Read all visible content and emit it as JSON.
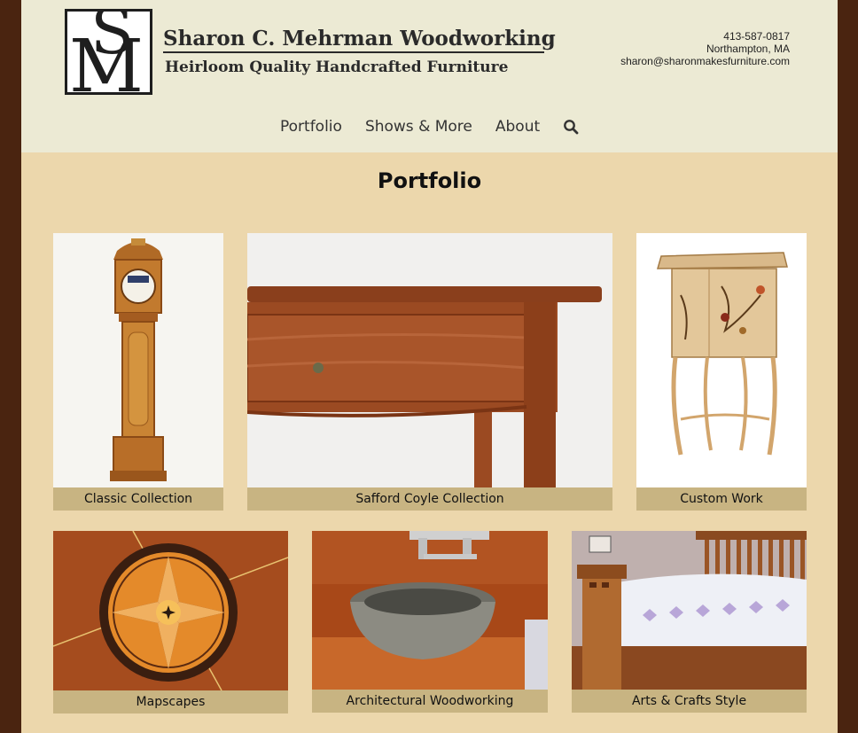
{
  "brand": {
    "logo_letters": "SM",
    "name": "Sharon C. Mehrman Woodworking",
    "tagline": "Heirloom Quality Handcrafted Furniture"
  },
  "contact": {
    "phone": "413-587-0817",
    "location": "Northampton, MA",
    "email": "sharon@sharonmakesfurniture.com"
  },
  "nav": {
    "items": [
      {
        "label": "Portfolio"
      },
      {
        "label": "Shows & More"
      },
      {
        "label": "About"
      }
    ],
    "search_icon": "search-icon"
  },
  "page": {
    "title": "Portfolio"
  },
  "portfolio": {
    "tiles": [
      {
        "label": "Classic Collection",
        "image": "tall case clock"
      },
      {
        "label": "Safford Coyle Collection",
        "image": "mahogany side table"
      },
      {
        "label": "Custom Work",
        "image": "inlaid cabinet on legs"
      },
      {
        "label": "Mapscapes",
        "image": "compass rose inlay"
      },
      {
        "label": "Architectural Woodworking",
        "image": "stone vessel sink vanity"
      },
      {
        "label": "Arts & Crafts Style",
        "image": "arts and crafts bed"
      }
    ]
  },
  "colors": {
    "outer_background": "#4a2410",
    "header_background": "#ecead4",
    "page_background": "#ecd7ac",
    "caption_background": "#c8b482"
  }
}
